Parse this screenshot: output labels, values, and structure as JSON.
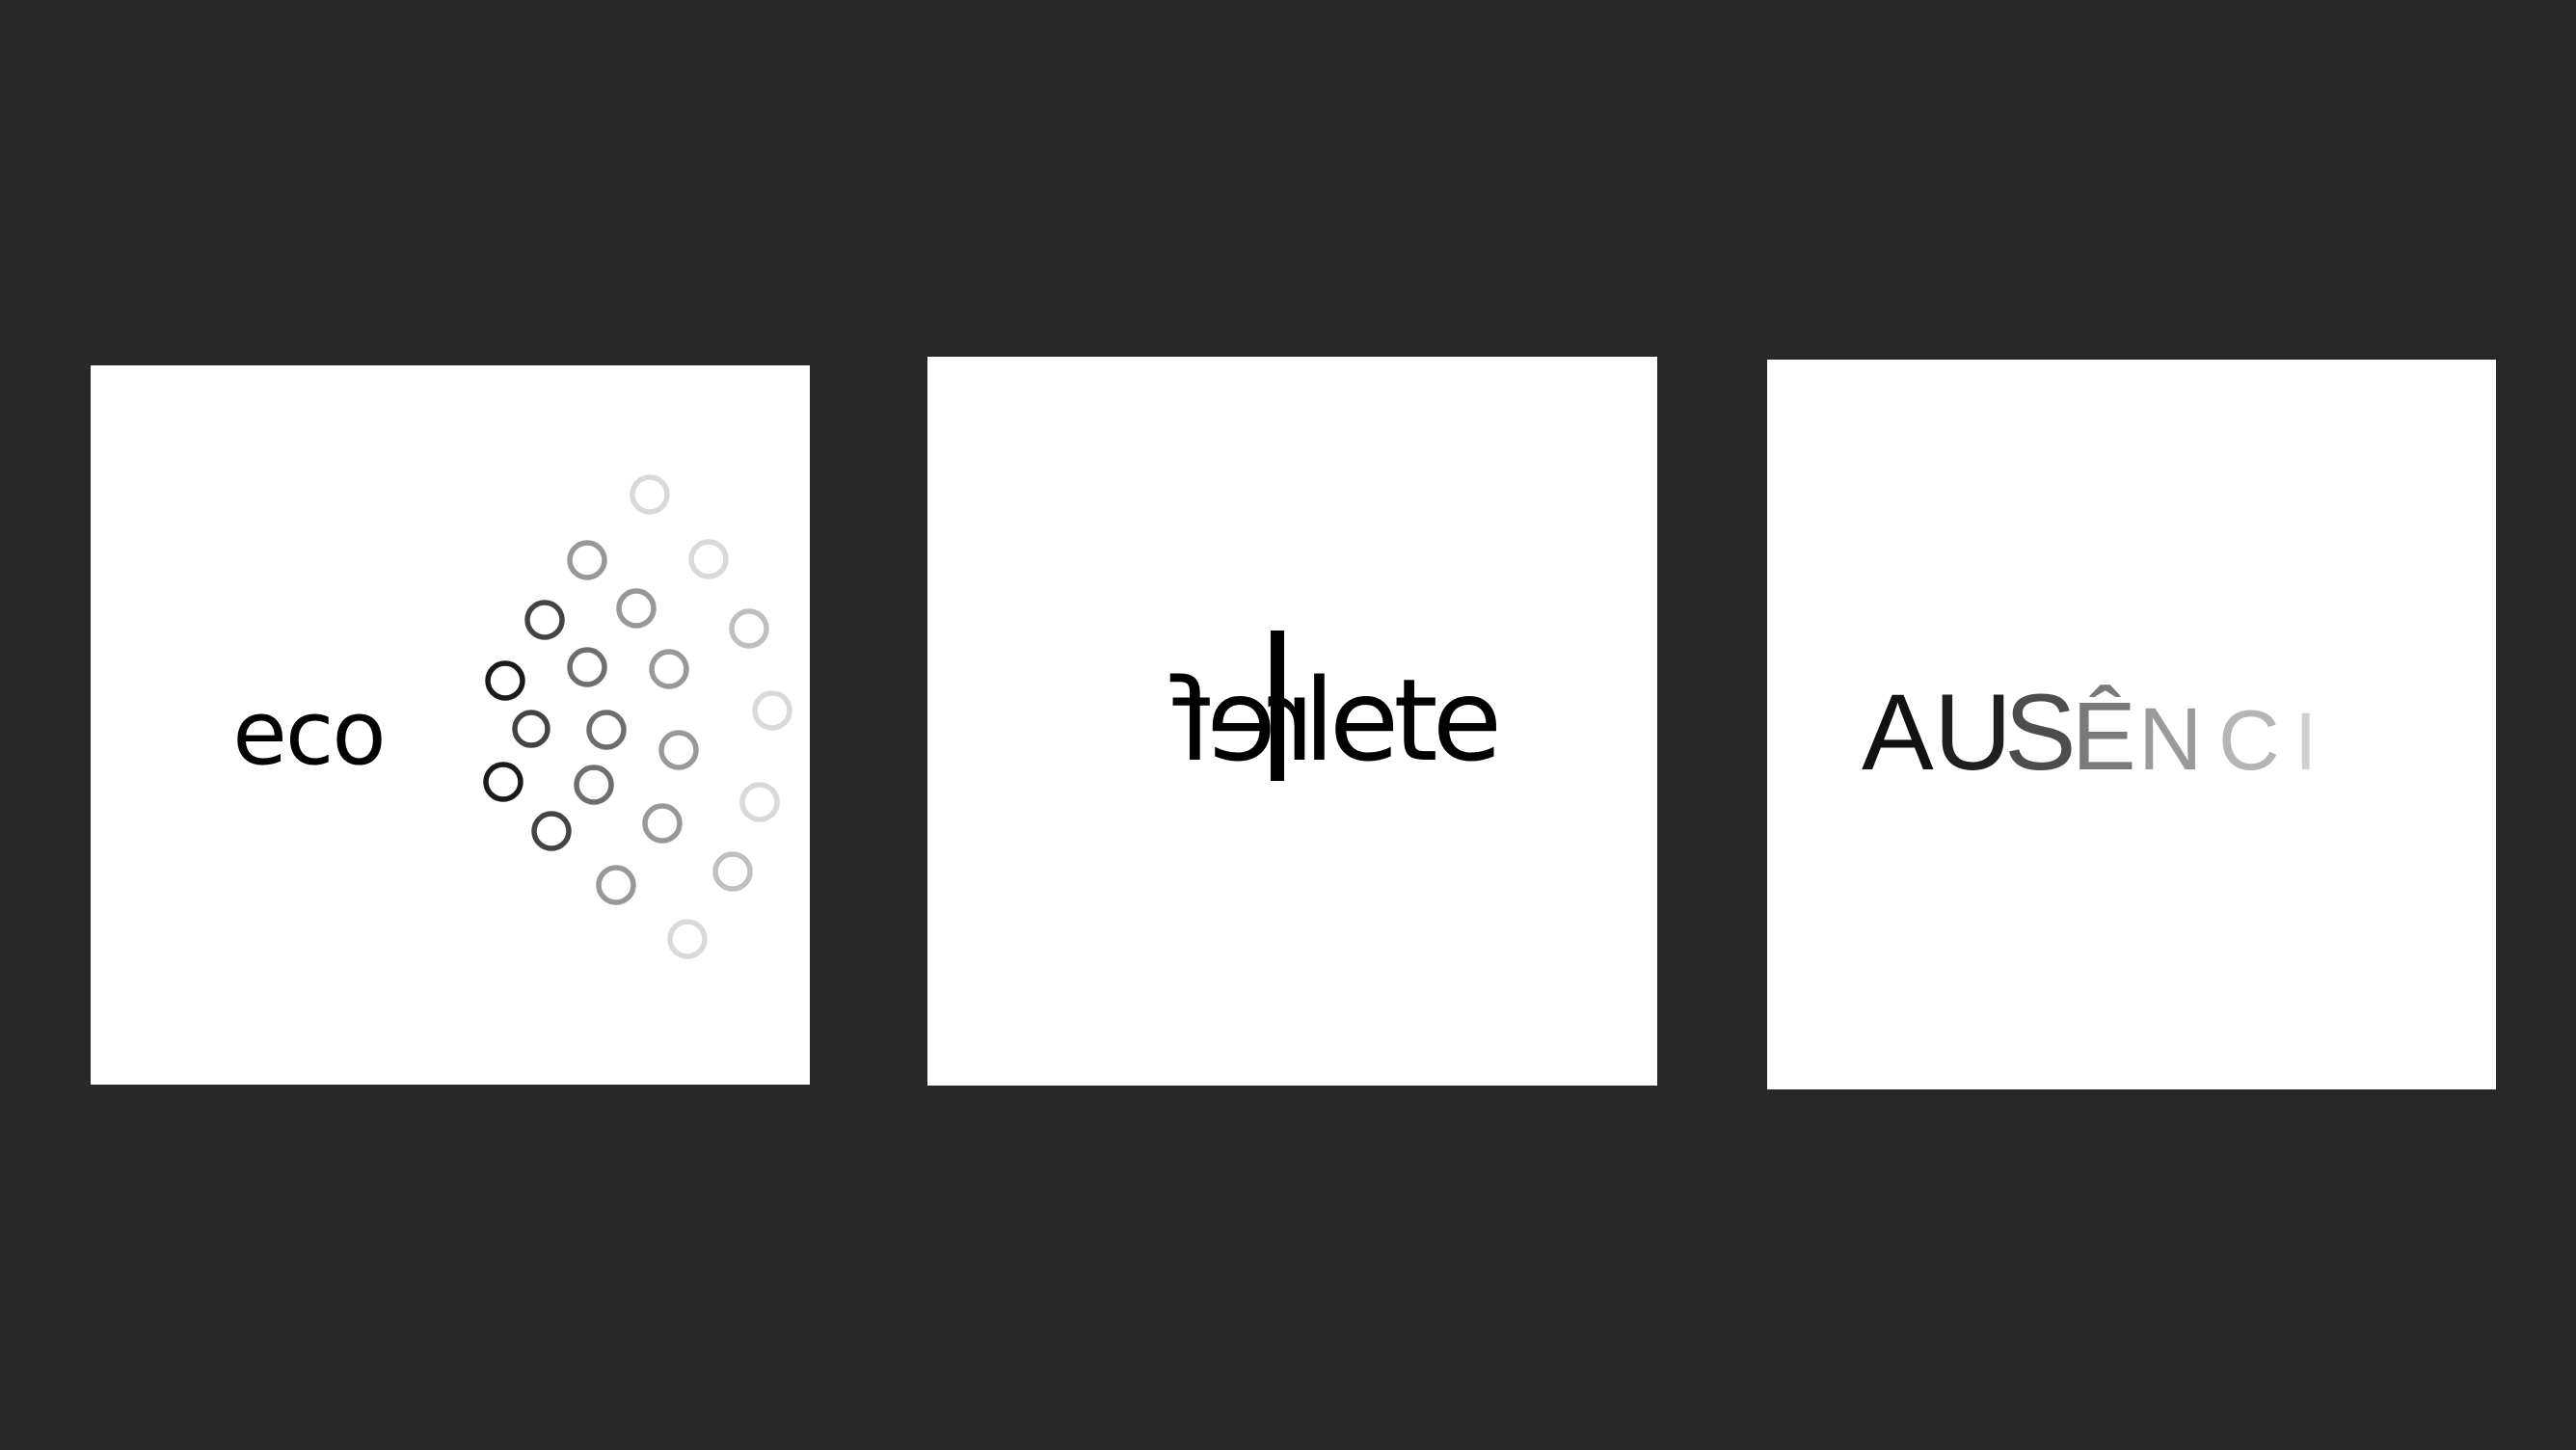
{
  "logos": [
    {
      "id": "eco",
      "word": "eco",
      "dot_color_steps": [
        "#1a1a1a",
        "#444444",
        "#6e6e6e",
        "#989898",
        "#bfbfbf",
        "#d9d9d9"
      ]
    },
    {
      "id": "reflete",
      "mirrored_part": "ref",
      "word_part": "lete"
    },
    {
      "id": "ausencia",
      "letters": [
        {
          "char": "A",
          "color": "#111111"
        },
        {
          "char": "U",
          "color": "#1f1f1f"
        },
        {
          "char": "S",
          "color": "#4d4d4d"
        },
        {
          "char": "Ê",
          "color": "#7a7a7a"
        },
        {
          "char": "N",
          "color": "#9a9a9a"
        },
        {
          "char": "C",
          "color": "#b5b5b5"
        },
        {
          "char": "I",
          "color": "#d0d0d0"
        }
      ]
    }
  ]
}
